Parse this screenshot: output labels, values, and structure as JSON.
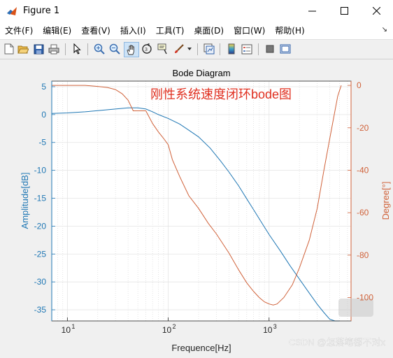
{
  "window": {
    "title": "Figure 1",
    "controls": {
      "minimize": "—",
      "maximize": "☐",
      "close": "✕"
    }
  },
  "menu": {
    "items": [
      "文件(F)",
      "编辑(E)",
      "查看(V)",
      "插入(I)",
      "工具(T)",
      "桌面(D)",
      "窗口(W)",
      "帮助(H)"
    ],
    "overflow": "↘"
  },
  "toolbar": {
    "buttons": [
      "new-figure",
      "open-file",
      "save",
      "print",
      "pointer",
      "zoom-in",
      "zoom-out",
      "pan",
      "rotate-3d",
      "data-cursor",
      "brush",
      "link-plot",
      "colorbar",
      "legend",
      "hide-plot-tools",
      "show-plot-tools"
    ],
    "active": "pan"
  },
  "watermark": {
    "text": "CSDN @怎落笔都不对x"
  },
  "colors": {
    "amplitude": "#1f77b4",
    "phase": "#d0623a",
    "annotation": "#e03020"
  },
  "chart_data": {
    "type": "line",
    "title": "Bode Diagram",
    "annotation": "刚性系统速度闭环bode图",
    "xlabel": "Frequence[Hz]",
    "ylabel_left": "Amplitude[dB]",
    "ylabel_right": "Degree[°]",
    "xscale": "log",
    "xlim": [
      7,
      6500
    ],
    "ylim_left": [
      -37,
      6
    ],
    "ylim_right": [
      -111,
      2
    ],
    "grid": true,
    "xticks": [
      {
        "value": 10,
        "label": "10",
        "sup": "1"
      },
      {
        "value": 100,
        "label": "10",
        "sup": "2"
      },
      {
        "value": 1000,
        "label": "10",
        "sup": "3"
      }
    ],
    "yticks_left": [
      "5",
      "0",
      "-5",
      "-10",
      "-15",
      "-20",
      "-25",
      "-30",
      "-35"
    ],
    "yticks_right": [
      "0",
      "-20",
      "-40",
      "-60",
      "-80",
      "-100"
    ],
    "series": [
      {
        "axis": "left",
        "x": [
          7,
          10,
          15,
          20,
          30,
          40,
          50,
          60,
          70,
          80,
          100,
          130,
          160,
          200,
          260,
          330,
          400,
          500,
          600,
          700,
          800,
          1000,
          1300,
          1600,
          2000,
          2500,
          3000,
          3500,
          4000,
          4500,
          5000
        ],
        "y": [
          0.2,
          0.3,
          0.5,
          0.7,
          1.0,
          1.2,
          1.2,
          1.0,
          0.5,
          0.0,
          -0.7,
          -1.7,
          -2.8,
          -4.0,
          -6.0,
          -8.3,
          -10.3,
          -12.8,
          -15.1,
          -17.0,
          -18.7,
          -21.5,
          -24.5,
          -27.0,
          -29.5,
          -32.0,
          -34.0,
          -35.5,
          -36.7,
          -37.5,
          -38.3
        ]
      },
      {
        "axis": "right",
        "x": [
          7,
          15,
          20,
          25,
          30,
          35,
          40,
          45,
          50,
          60,
          70,
          80,
          90,
          100,
          110,
          130,
          160,
          200,
          250,
          300,
          400,
          500,
          600,
          700,
          800,
          900,
          1000,
          1100,
          1200,
          1400,
          1700,
          2000,
          2500,
          3000,
          3500,
          4000,
          4500,
          4800,
          5200
        ],
        "y": [
          0,
          0,
          -0.5,
          -1,
          -2,
          -4,
          -7,
          -12,
          -12,
          -12,
          -18,
          -22,
          -25,
          -28,
          -35,
          -43,
          -52,
          -58,
          -65,
          -70,
          -79,
          -87,
          -93,
          -97,
          -100,
          -102,
          -103,
          -103.5,
          -103,
          -100,
          -94,
          -86,
          -73,
          -58,
          -40,
          -25,
          -12,
          -5,
          0
        ]
      }
    ]
  }
}
